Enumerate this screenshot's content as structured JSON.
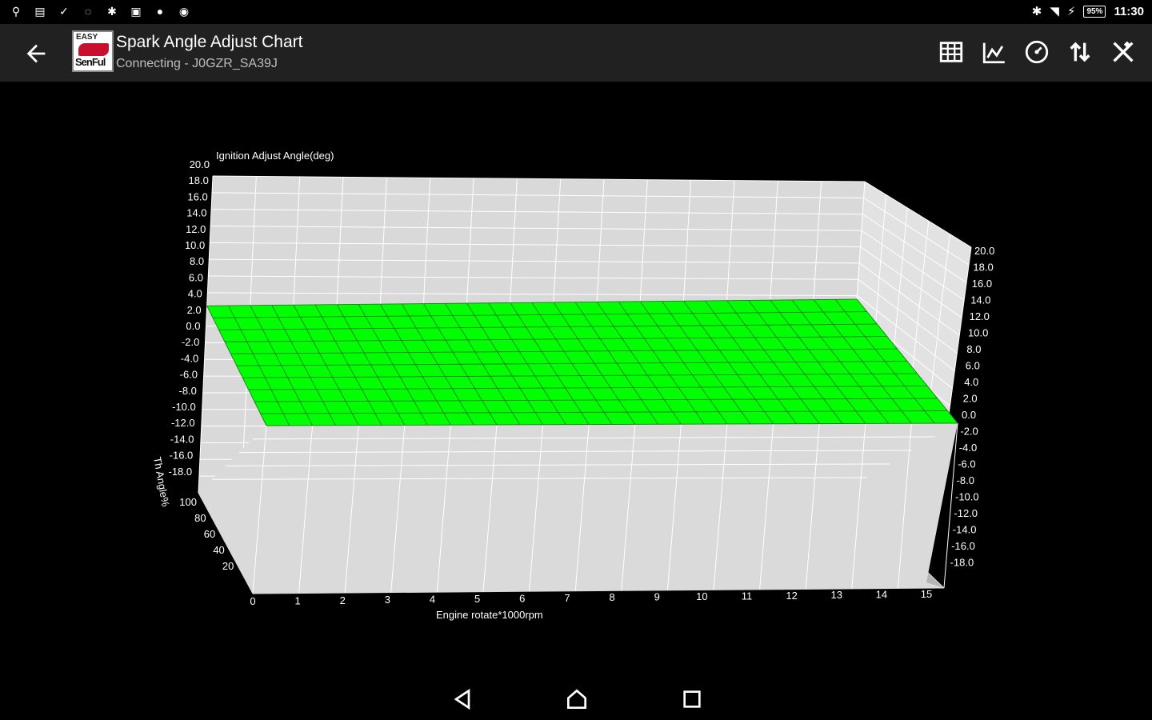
{
  "status_bar": {
    "left_icons": [
      "usb-icon",
      "download-icon",
      "check-download-icon",
      "sync-icon",
      "bluetooth-icon",
      "image-icon",
      "chat-icon",
      "circle-icon"
    ],
    "battery": "95%",
    "time": "11:30"
  },
  "app_bar": {
    "logo_text_top": "EASY",
    "logo_text_bottom": "SenFul",
    "title": "Spark Angle Adjust Chart",
    "subtitle": "Connecting - J0GZR_SA39J",
    "actions": [
      "table-icon",
      "line-chart-icon",
      "gauge-icon",
      "swap-vert-icon",
      "tools-icon"
    ]
  },
  "chart_data": {
    "type": "surface-3d",
    "z_axis_title": "Ignition Adjust Angle(deg)",
    "x_axis_title": "Engine rotate*1000rpm",
    "y_axis_title": "Th Angle%",
    "z_ticks": [
      "20.0",
      "18.0",
      "16.0",
      "14.0",
      "12.0",
      "10.0",
      "8.0",
      "6.0",
      "4.0",
      "2.0",
      "0.0",
      "-2.0",
      "-4.0",
      "-6.0",
      "-8.0",
      "-10.0",
      "-12.0",
      "-14.0",
      "-16.0",
      "-18.0"
    ],
    "right_z_ticks": [
      "20.0",
      "18.0",
      "16.0",
      "14.0",
      "12.0",
      "10.0",
      "8.0",
      "6.0",
      "4.0",
      "2.0",
      "0.0",
      "-2.0",
      "-4.0",
      "-6.0",
      "-8.0",
      "-10.0",
      "-12.0",
      "-14.0",
      "-16.0",
      "-18.0"
    ],
    "x_ticks": [
      "0",
      "1",
      "2",
      "3",
      "4",
      "5",
      "6",
      "7",
      "8",
      "9",
      "10",
      "11",
      "12",
      "13",
      "14",
      "15"
    ],
    "y_ticks": [
      "100",
      "80",
      "60",
      "40",
      "20"
    ],
    "zlim": [
      -20,
      20
    ],
    "xlim": [
      0,
      15
    ],
    "ylim": [
      0,
      100
    ],
    "surface_value": 0.0,
    "surface_color": "#00ff00",
    "panel_color": "#d9d9d9",
    "floor_color": "#b5b5b5"
  }
}
